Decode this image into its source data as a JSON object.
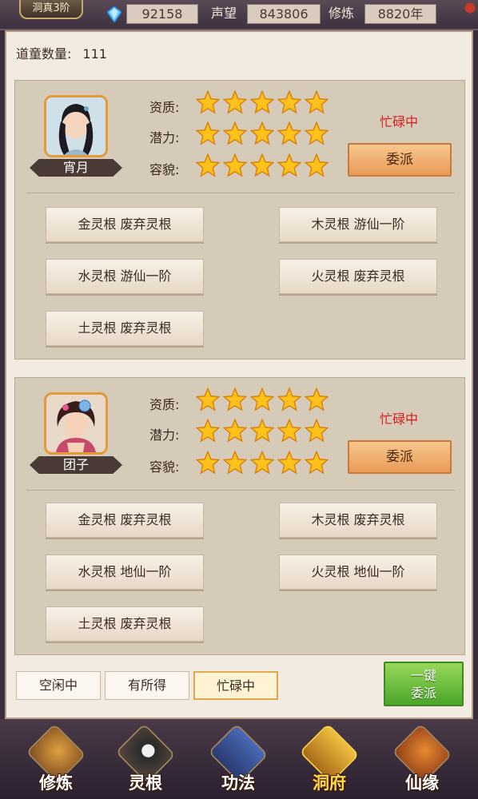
{
  "topbar": {
    "rank": "洞真3阶",
    "gem_icon": "gem-icon",
    "gems": "92158",
    "reputation_label": "声望",
    "reputation": "843806",
    "cultivation_label": "修炼",
    "cultivation": "8820年"
  },
  "count": {
    "label": "道童数量:",
    "value": "111"
  },
  "servants": [
    {
      "name": "宵月",
      "attrs": [
        {
          "label": "资质:",
          "stars": 5
        },
        {
          "label": "潜力:",
          "stars": 5
        },
        {
          "label": "容貌:",
          "stars": 5
        }
      ],
      "status": "忙碌中",
      "dispatch": "委派",
      "roots": [
        "金灵根 废弃灵根",
        "木灵根 游仙一阶",
        "水灵根 游仙一阶",
        "火灵根 废弃灵根",
        "土灵根 废弃灵根"
      ]
    },
    {
      "name": "团子",
      "attrs": [
        {
          "label": "资质:",
          "stars": 5
        },
        {
          "label": "潜力:",
          "stars": 5
        },
        {
          "label": "容貌:",
          "stars": 5
        }
      ],
      "status": "忙碌中",
      "dispatch": "委派",
      "roots": [
        "金灵根 废弃灵根",
        "木灵根 废弃灵根",
        "水灵根 地仙一阶",
        "火灵根 地仙一阶",
        "土灵根 废弃灵根"
      ]
    }
  ],
  "filters": [
    "空闲中",
    "有所得",
    "忙碌中"
  ],
  "active_filter": "忙碌中",
  "one_click": {
    "line1": "一键",
    "line2": "委派"
  },
  "nav": [
    {
      "label": "修炼",
      "icon": "cultivation-icon"
    },
    {
      "label": "灵根",
      "icon": "spirit-root-icon"
    },
    {
      "label": "功法",
      "icon": "technique-icon"
    },
    {
      "label": "洞府",
      "icon": "cave-abode-icon",
      "active": true
    },
    {
      "label": "仙缘",
      "icon": "immortal-fate-icon"
    }
  ],
  "colors": {
    "status_red": "#d61e1e",
    "accent_orange": "#e99a55",
    "green_button": "#4aa52a",
    "active_nav": "#ffd84a"
  }
}
